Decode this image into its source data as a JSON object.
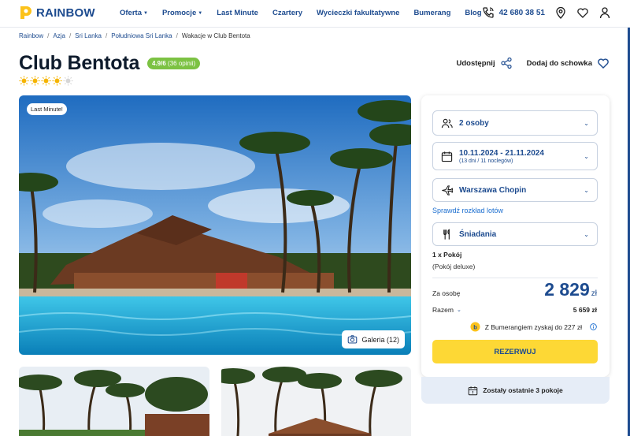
{
  "brand": {
    "name": "RAINBOW"
  },
  "nav": [
    {
      "label": "Oferta",
      "dropdown": true
    },
    {
      "label": "Promocje",
      "dropdown": true
    },
    {
      "label": "Last Minute",
      "dropdown": false
    },
    {
      "label": "Czartery",
      "dropdown": false
    },
    {
      "label": "Wycieczki fakultatywne",
      "dropdown": false
    },
    {
      "label": "Bumerang",
      "dropdown": false
    },
    {
      "label": "Blog",
      "dropdown": false
    }
  ],
  "header": {
    "phone": "42 680 38 51"
  },
  "breadcrumb": [
    "Rainbow",
    "Azja",
    "Sri Lanka",
    "Południowa Sri Lanka",
    "Wakacje w Club Bentota"
  ],
  "hotel": {
    "name": "Club Bentota",
    "rating": "4.9/6",
    "reviews": "(36 opinii)",
    "stars_filled": 4,
    "stars_half": 0,
    "stars_total": 5
  },
  "actions": {
    "share": "Udostępnij",
    "save": "Dodaj do schowka"
  },
  "gallery": {
    "badge": "Last Minute!",
    "button": "Galeria (12)"
  },
  "booking": {
    "persons": "2 osoby",
    "dates": "10.11.2024 - 21.11.2024",
    "dates_sub": "(13 dni / 11 noclegów)",
    "airport": "Warszawa Chopin",
    "flight_link": "Sprawdź rozkład lotów",
    "board": "Śniadania",
    "room_count": "1 x Pokój",
    "room_type": "(Pokój deluxe)",
    "per_person_label": "Za osobę",
    "price": "2 829",
    "currency": "zł",
    "total_label": "Razem",
    "total_value": "5 659 zł",
    "bumerang_text": "Z Bumerangiem zyskaj do 227 zł",
    "reserve": "REZERWUJ",
    "rooms_left": "Zostały ostatnie 3 pokoje"
  },
  "colors": {
    "brand_blue": "#1d4b8f",
    "accent_yellow": "#fdd835",
    "rating_green": "#7cc243"
  }
}
